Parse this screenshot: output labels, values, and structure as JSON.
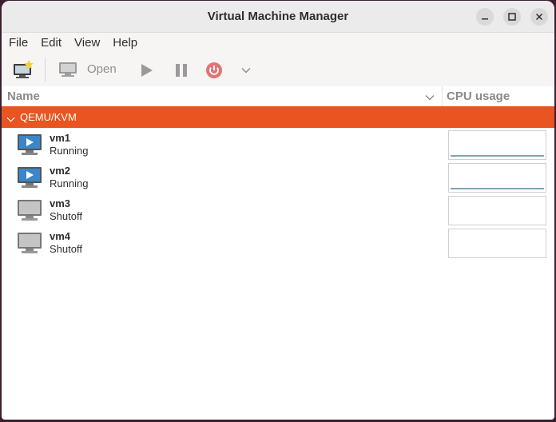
{
  "window": {
    "title": "Virtual Machine Manager"
  },
  "menu": [
    "File",
    "Edit",
    "View",
    "Help"
  ],
  "toolbar": {
    "open_label": "Open"
  },
  "columns": {
    "name": "Name",
    "cpu": "CPU usage"
  },
  "group": {
    "label": "QEMU/KVM"
  },
  "vms": [
    {
      "name": "vm1",
      "status": "Running"
    },
    {
      "name": "vm2",
      "status": "Running"
    },
    {
      "name": "vm3",
      "status": "Shutoff"
    },
    {
      "name": "vm4",
      "status": "Shutoff"
    }
  ],
  "colors": {
    "accent": "#e95420",
    "titlebar": "#ebebeb",
    "power": "#e07575",
    "cpu_line": "#7fa3b3"
  }
}
